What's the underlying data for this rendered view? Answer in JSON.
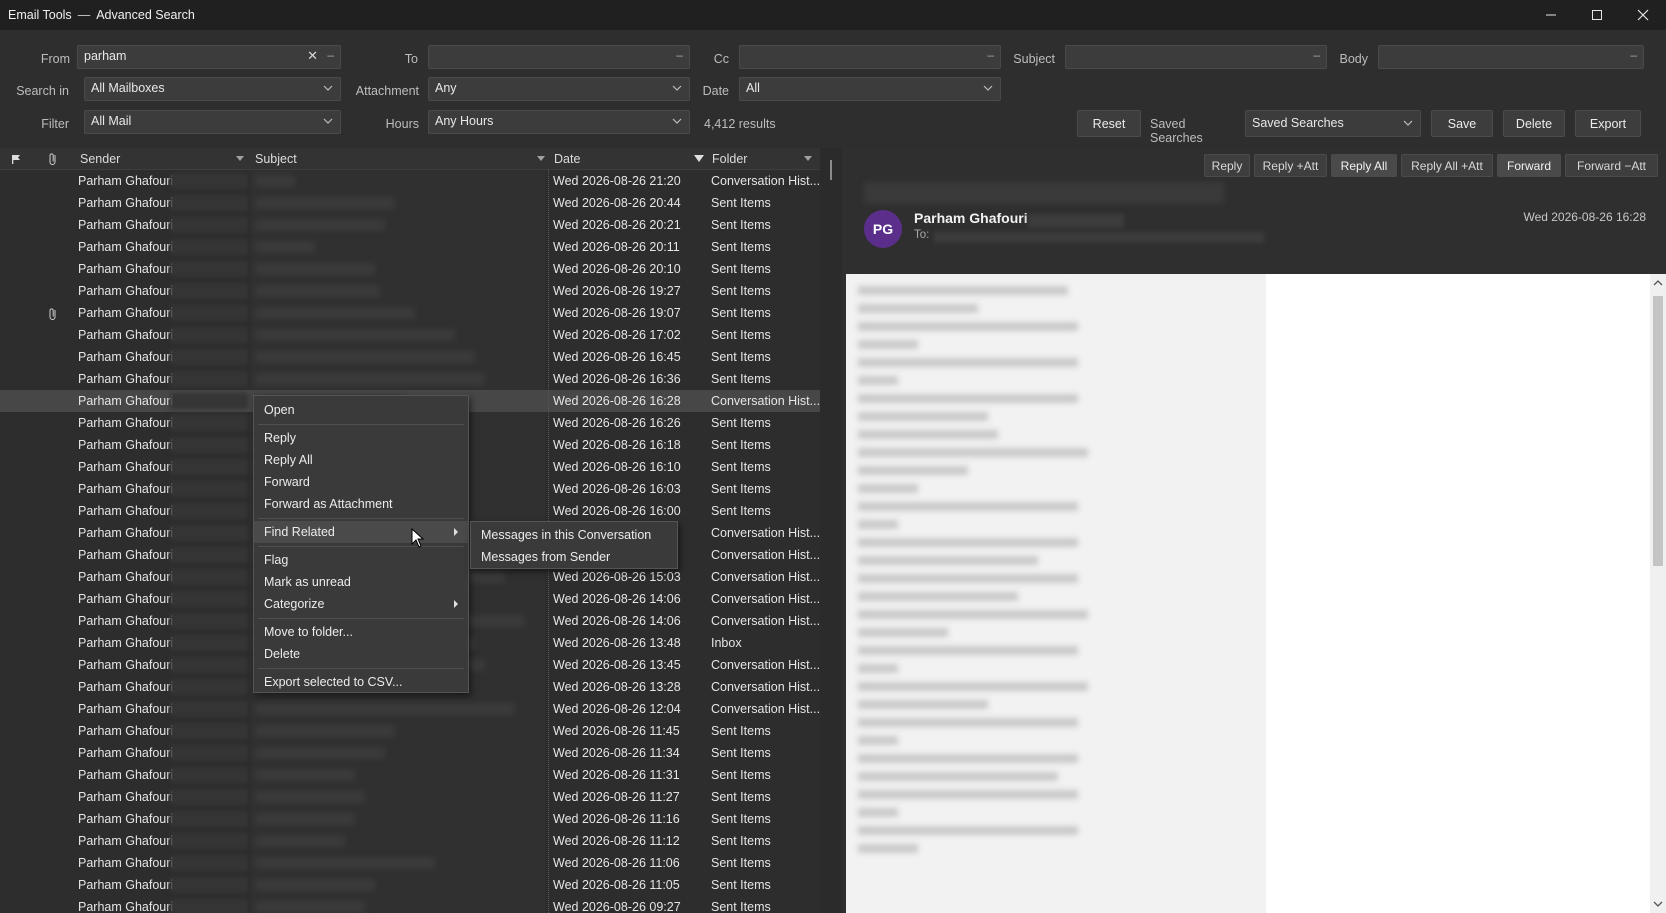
{
  "window": {
    "app": "Email Tools",
    "separator": "—",
    "title": "Advanced Search"
  },
  "search": {
    "from_label": "From",
    "from_value": "parham",
    "to_label": "To",
    "cc_label": "Cc",
    "subject_label": "Subject",
    "body_label": "Body",
    "search_in_label": "Search in",
    "search_in_value": "All Mailboxes",
    "attachment_label": "Attachment",
    "attachment_value": "Any",
    "date_label": "Date",
    "date_value": "All",
    "filter_label": "Filter",
    "filter_value": "All Mail",
    "hours_label": "Hours",
    "hours_value": "Any Hours",
    "results": "4,412 results",
    "reset_label": "Reset",
    "saved_searches_label": "Saved Searches",
    "saved_searches_value": "Saved Searches",
    "save_label": "Save",
    "delete_label": "Delete",
    "export_label": "Export"
  },
  "list": {
    "headers": {
      "sender": "Sender",
      "subject": "Subject",
      "date": "Date",
      "folder": "Folder"
    },
    "rows": [
      {
        "sender": "Parham Ghafouri",
        "date": "Wed 2026-08-26 21:20",
        "folder": "Conversation Hist..."
      },
      {
        "sender": "Parham Ghafouri",
        "date": "Wed 2026-08-26 20:44",
        "folder": "Sent Items"
      },
      {
        "sender": "Parham Ghafouri",
        "date": "Wed 2026-08-26 20:21",
        "folder": "Sent Items"
      },
      {
        "sender": "Parham Ghafouri",
        "date": "Wed 2026-08-26 20:11",
        "folder": "Sent Items"
      },
      {
        "sender": "Parham Ghafouri",
        "date": "Wed 2026-08-26 20:10",
        "folder": "Sent Items"
      },
      {
        "sender": "Parham Ghafouri",
        "date": "Wed 2026-08-26 19:27",
        "folder": "Sent Items"
      },
      {
        "sender": "Parham Ghafouri",
        "date": "Wed 2026-08-26 19:07",
        "folder": "Sent Items",
        "attachment": true
      },
      {
        "sender": "Parham Ghafouri",
        "date": "Wed 2026-08-26 17:02",
        "folder": "Sent Items"
      },
      {
        "sender": "Parham Ghafouri",
        "date": "Wed 2026-08-26 16:45",
        "folder": "Sent Items"
      },
      {
        "sender": "Parham Ghafouri",
        "date": "Wed 2026-08-26 16:36",
        "folder": "Sent Items"
      },
      {
        "sender": "Parham Ghafouri",
        "date": "Wed 2026-08-26 16:28",
        "folder": "Conversation Hist...",
        "selected": true
      },
      {
        "sender": "Parham Ghafouri",
        "date": "Wed 2026-08-26 16:26",
        "folder": "Sent Items"
      },
      {
        "sender": "Parham Ghafouri",
        "date": "Wed 2026-08-26 16:18",
        "folder": "Sent Items"
      },
      {
        "sender": "Parham Ghafouri",
        "date": "Wed 2026-08-26 16:10",
        "folder": "Sent Items"
      },
      {
        "sender": "Parham Ghafouri",
        "date": "Wed 2026-08-26 16:03",
        "folder": "Sent Items"
      },
      {
        "sender": "Parham Ghafouri",
        "date": "Wed 2026-08-26 16:00",
        "folder": "Sent Items"
      },
      {
        "sender": "Parham Ghafouri",
        "date": "",
        "folder": "Conversation Hist..."
      },
      {
        "sender": "Parham Ghafouri",
        "date": "",
        "folder": "Conversation Hist..."
      },
      {
        "sender": "Parham Ghafouri",
        "date": "Wed 2026-08-26 15:03",
        "folder": "Conversation Hist..."
      },
      {
        "sender": "Parham Ghafouri",
        "date": "Wed 2026-08-26 14:06",
        "folder": "Conversation Hist..."
      },
      {
        "sender": "Parham Ghafouri",
        "date": "Wed 2026-08-26 14:06",
        "folder": "Conversation Hist..."
      },
      {
        "sender": "Parham Ghafouri",
        "date": "Wed 2026-08-26 13:48",
        "folder": "Inbox"
      },
      {
        "sender": "Parham Ghafouri",
        "date": "Wed 2026-08-26 13:45",
        "folder": "Conversation Hist..."
      },
      {
        "sender": "Parham Ghafouri",
        "date": "Wed 2026-08-26 13:28",
        "folder": "Conversation Hist..."
      },
      {
        "sender": "Parham Ghafouri",
        "date": "Wed 2026-08-26 12:04",
        "folder": "Conversation Hist..."
      },
      {
        "sender": "Parham Ghafouri",
        "date": "Wed 2026-08-26 11:45",
        "folder": "Sent Items"
      },
      {
        "sender": "Parham Ghafouri",
        "date": "Wed 2026-08-26 11:34",
        "folder": "Sent Items"
      },
      {
        "sender": "Parham Ghafouri",
        "date": "Wed 2026-08-26 11:31",
        "folder": "Sent Items"
      },
      {
        "sender": "Parham Ghafouri",
        "date": "Wed 2026-08-26 11:27",
        "folder": "Sent Items"
      },
      {
        "sender": "Parham Ghafouri",
        "date": "Wed 2026-08-26 11:16",
        "folder": "Sent Items"
      },
      {
        "sender": "Parham Ghafouri",
        "date": "Wed 2026-08-26 11:12",
        "folder": "Sent Items"
      },
      {
        "sender": "Parham Ghafouri",
        "date": "Wed 2026-08-26 11:06",
        "folder": "Sent Items"
      },
      {
        "sender": "Parham Ghafouri",
        "date": "Wed 2026-08-26 11:05",
        "folder": "Sent Items"
      },
      {
        "sender": "Parham Ghafouri",
        "date": "Wed 2026-08-26 09:27",
        "folder": "Sent Items"
      }
    ]
  },
  "preview": {
    "buttons": [
      "Reply",
      "Reply +Att",
      "Reply All",
      "Reply All +Att",
      "Forward",
      "Forward −Att"
    ],
    "avatar_initials": "PG",
    "from_name": "Parham Ghafouri",
    "to_label": "To:",
    "date": "Wed 2026-08-26 16:28"
  },
  "context_menu": {
    "items": [
      "Open",
      "Reply",
      "Reply All",
      "Forward",
      "Forward as Attachment",
      "Find Related",
      "Flag",
      "Mark as unread",
      "Categorize",
      "Move to folder...",
      "Delete",
      "Export selected to CSV..."
    ],
    "submenu": [
      "Messages in this Conversation",
      "Messages from Sender"
    ]
  }
}
